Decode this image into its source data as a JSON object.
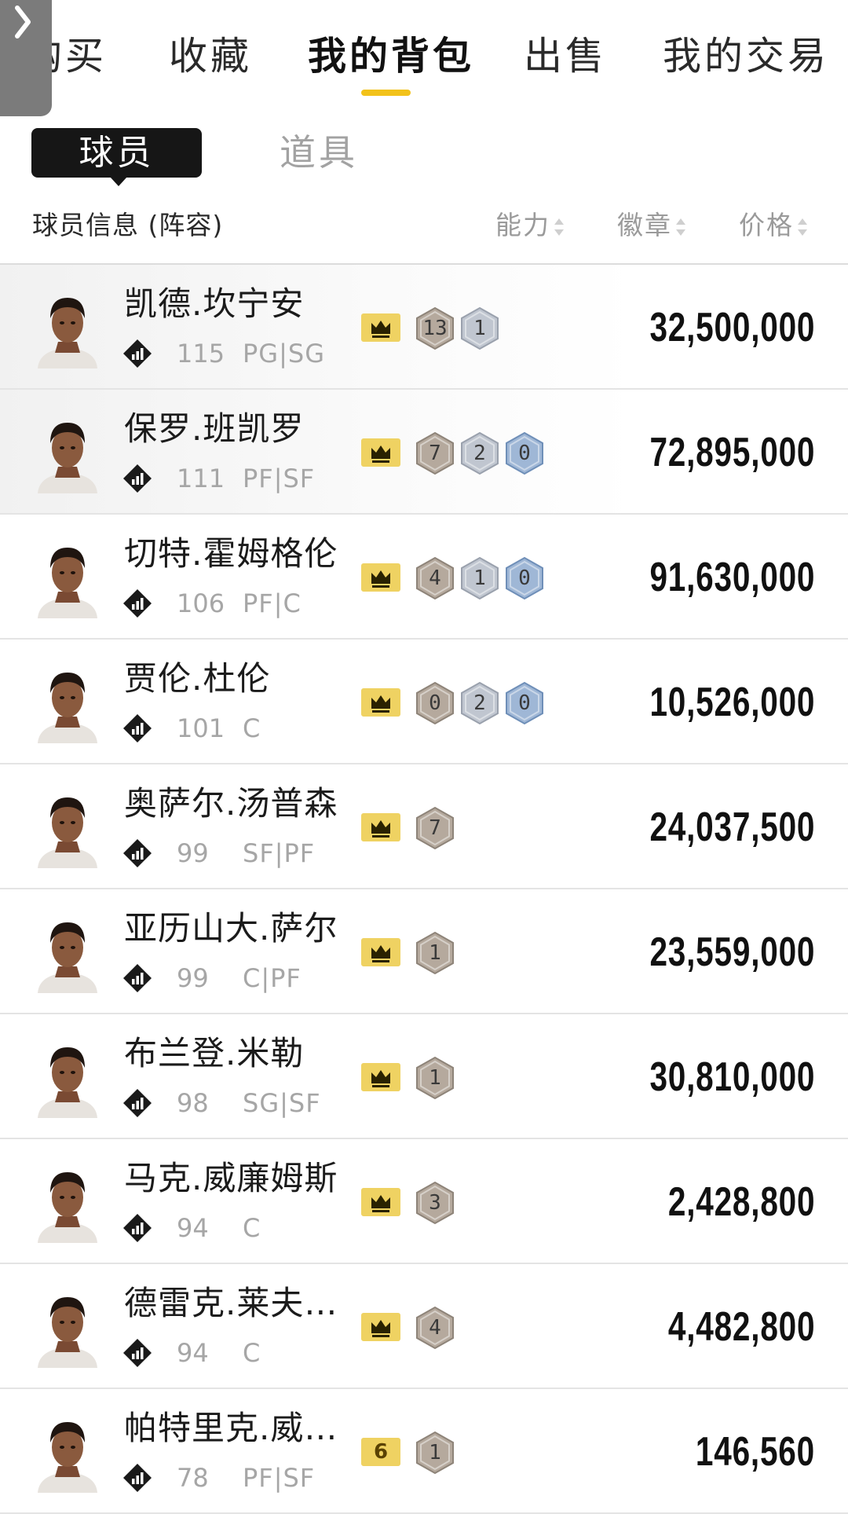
{
  "tabs": [
    {
      "label": "购买",
      "active": false
    },
    {
      "label": "收藏",
      "active": false
    },
    {
      "label": "我的背包",
      "active": true
    },
    {
      "label": "出售",
      "active": false
    },
    {
      "label": "我的交易",
      "active": false
    }
  ],
  "subtabs": {
    "players": "球员",
    "items": "道具"
  },
  "header": {
    "info": "球员信息 (阵容)",
    "ability": "能力",
    "badges": "徽章",
    "price": "价格"
  },
  "colors": {
    "accent": "#f2c21a",
    "crown": "#efd262",
    "badge_bronze": "#b5a99d",
    "badge_silver": "#c0c6d0",
    "badge_blue": "#9fb7d6"
  },
  "players": [
    {
      "name": "凯德.坎宁安",
      "ovr": "115",
      "pos": "PG|SG",
      "crown": "crown-icon",
      "badges": [
        {
          "tier": "bronze",
          "count": "13"
        },
        {
          "tier": "silver",
          "count": "1"
        }
      ],
      "price": "32,500,000"
    },
    {
      "name": "保罗.班凯罗",
      "ovr": "111",
      "pos": "PF|SF",
      "crown": "crown-icon",
      "badges": [
        {
          "tier": "bronze",
          "count": "7"
        },
        {
          "tier": "silver",
          "count": "2"
        },
        {
          "tier": "blue",
          "count": "0"
        }
      ],
      "price": "72,895,000"
    },
    {
      "name": "切特.霍姆格伦",
      "ovr": "106",
      "pos": "PF|C",
      "crown": "crown-icon",
      "badges": [
        {
          "tier": "bronze",
          "count": "4"
        },
        {
          "tier": "silver",
          "count": "1"
        },
        {
          "tier": "blue",
          "count": "0"
        }
      ],
      "price": "91,630,000"
    },
    {
      "name": "贾伦.杜伦",
      "ovr": "101",
      "pos": "C",
      "crown": "crown-icon",
      "badges": [
        {
          "tier": "bronze",
          "count": "0"
        },
        {
          "tier": "silver",
          "count": "2"
        },
        {
          "tier": "blue",
          "count": "0"
        }
      ],
      "price": "10,526,000"
    },
    {
      "name": "奥萨尔.汤普森",
      "ovr": "99",
      "pos": "SF|PF",
      "crown": "crown-icon",
      "badges": [
        {
          "tier": "bronze",
          "count": "7"
        }
      ],
      "price": "24,037,500"
    },
    {
      "name": "亚历山大.萨尔",
      "ovr": "99",
      "pos": "C|PF",
      "crown": "crown-icon",
      "badges": [
        {
          "tier": "bronze",
          "count": "1"
        }
      ],
      "price": "23,559,000"
    },
    {
      "name": "布兰登.米勒",
      "ovr": "98",
      "pos": "SG|SF",
      "crown": "crown-icon",
      "badges": [
        {
          "tier": "bronze",
          "count": "1"
        }
      ],
      "price": "30,810,000"
    },
    {
      "name": "马克.威廉姆斯",
      "ovr": "94",
      "pos": "C",
      "crown": "crown-icon",
      "badges": [
        {
          "tier": "bronze",
          "count": "3"
        }
      ],
      "price": "2,428,800"
    },
    {
      "name": "德雷克.莱夫…",
      "ovr": "94",
      "pos": "C",
      "crown": "crown-icon",
      "badges": [
        {
          "tier": "bronze",
          "count": "4"
        }
      ],
      "price": "4,482,800"
    },
    {
      "name": "帕特里克.威…",
      "ovr": "78",
      "pos": "PF|SF",
      "crown": "6",
      "badges": [
        {
          "tier": "bronze",
          "count": "1"
        }
      ],
      "price": "146,560"
    }
  ]
}
